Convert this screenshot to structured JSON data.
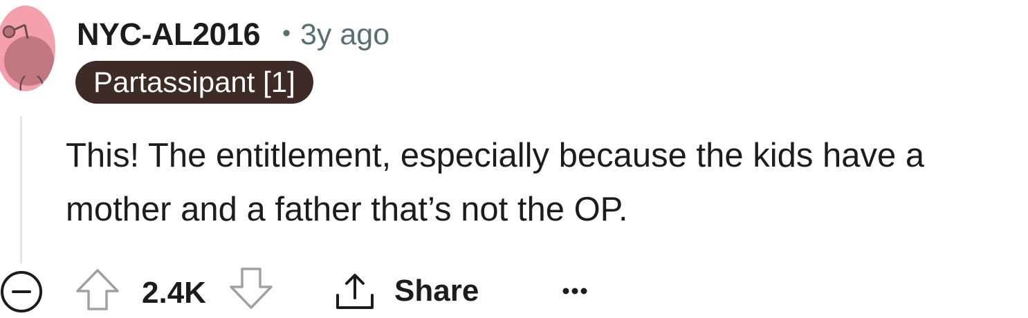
{
  "comment": {
    "author": "NYC-AL2016",
    "separator": "•",
    "timestamp": "3y ago",
    "flair": "Partassipant [1]",
    "body_lines": [
      "This! The entitlement, especially because the kids have a",
      "mother and a father that’s not the OP."
    ]
  },
  "actions": {
    "collapse_icon": "minus-circle-icon",
    "upvote_icon": "arrow-up-outline-icon",
    "score": "2.4K",
    "downvote_icon": "arrow-down-outline-icon",
    "share_icon": "share-upload-icon",
    "share_label": "Share",
    "more_icon": "ellipsis-icon"
  },
  "colors": {
    "avatar_bg": "#f4a0ad",
    "flair_bg": "#3f2b26",
    "meta_text": "#576f76",
    "icon_outline": "#a0a0a0",
    "text": "#1c1c1c"
  }
}
